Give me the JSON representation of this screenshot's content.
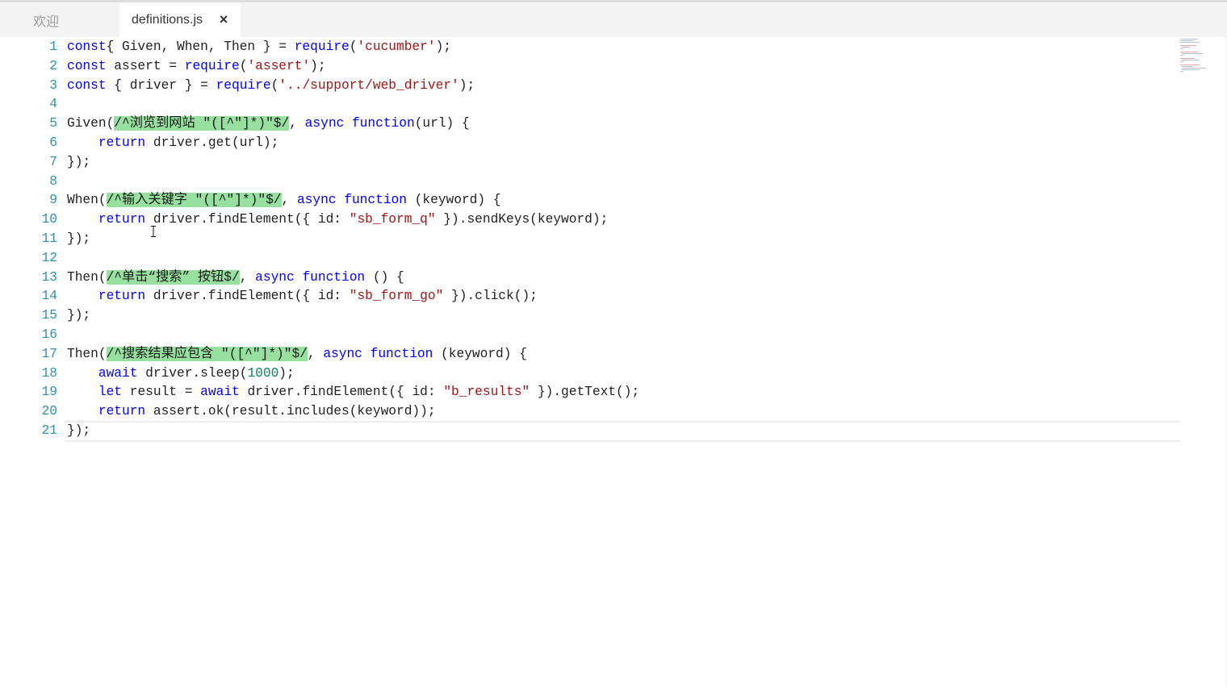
{
  "tabs": [
    {
      "label": "欢迎",
      "active": false
    },
    {
      "label": "definitions.js",
      "active": true,
      "close_icon": "×"
    }
  ],
  "colors": {
    "keyword": "#0000ff",
    "string": "#a31515",
    "number": "#098658",
    "line_number": "#2b91af",
    "regex_highlight": "#98e0a0"
  },
  "editor": {
    "lines": [
      {
        "n": "1",
        "tokens": [
          [
            "kw",
            "const"
          ],
          [
            "",
            "{ Given, When, Then } = "
          ],
          [
            "kw",
            "require"
          ],
          [
            "",
            "("
          ],
          [
            "str",
            "'cucumber'"
          ],
          [
            "",
            ");"
          ]
        ]
      },
      {
        "n": "2",
        "tokens": [
          [
            "kw",
            "const"
          ],
          [
            "",
            " assert = "
          ],
          [
            "kw",
            "require"
          ],
          [
            "",
            "("
          ],
          [
            "str",
            "'assert'"
          ],
          [
            "",
            ");"
          ]
        ]
      },
      {
        "n": "3",
        "tokens": [
          [
            "kw",
            "const"
          ],
          [
            "",
            " { driver } = "
          ],
          [
            "kw",
            "require"
          ],
          [
            "",
            "("
          ],
          [
            "str",
            "'../support/web_driver'"
          ],
          [
            "",
            ");"
          ]
        ]
      },
      {
        "n": "4",
        "tokens": []
      },
      {
        "n": "5",
        "tokens": [
          [
            "",
            "Given("
          ],
          [
            "rx",
            "/^浏览到网站 \"([^\"]*)\"$/"
          ],
          [
            "",
            ", "
          ],
          [
            "kw",
            "async"
          ],
          [
            "",
            " "
          ],
          [
            "kw",
            "function"
          ],
          [
            "",
            "(url) {"
          ]
        ]
      },
      {
        "n": "6",
        "tokens": [
          [
            "",
            "    "
          ],
          [
            "kw",
            "return"
          ],
          [
            "",
            " driver.get(url);"
          ]
        ]
      },
      {
        "n": "7",
        "tokens": [
          [
            "",
            "});"
          ]
        ]
      },
      {
        "n": "8",
        "tokens": []
      },
      {
        "n": "9",
        "tokens": [
          [
            "",
            "When("
          ],
          [
            "rx",
            "/^输入关键字 \"([^\"]*)\"$/"
          ],
          [
            "",
            ", "
          ],
          [
            "kw",
            "async"
          ],
          [
            "",
            " "
          ],
          [
            "kw",
            "function"
          ],
          [
            "",
            " (keyword) {"
          ]
        ]
      },
      {
        "n": "10",
        "tokens": [
          [
            "",
            "    "
          ],
          [
            "kw",
            "return"
          ],
          [
            "",
            " driver.findElement({ id: "
          ],
          [
            "str",
            "\"sb_form_q\""
          ],
          [
            "",
            " }).sendKeys(keyword);"
          ]
        ]
      },
      {
        "n": "11",
        "tokens": [
          [
            "",
            "});"
          ]
        ]
      },
      {
        "n": "12",
        "tokens": []
      },
      {
        "n": "13",
        "tokens": [
          [
            "",
            "Then("
          ],
          [
            "rx",
            "/^单击“搜索” 按钮$/"
          ],
          [
            "",
            ", "
          ],
          [
            "kw",
            "async"
          ],
          [
            "",
            " "
          ],
          [
            "kw",
            "function"
          ],
          [
            "",
            " () {"
          ]
        ]
      },
      {
        "n": "14",
        "tokens": [
          [
            "",
            "    "
          ],
          [
            "kw",
            "return"
          ],
          [
            "",
            " driver.findElement({ id: "
          ],
          [
            "str",
            "\"sb_form_go\""
          ],
          [
            "",
            " }).click();"
          ]
        ]
      },
      {
        "n": "15",
        "tokens": [
          [
            "",
            "});"
          ]
        ]
      },
      {
        "n": "16",
        "tokens": []
      },
      {
        "n": "17",
        "tokens": [
          [
            "",
            "Then("
          ],
          [
            "rx",
            "/^搜索结果应包含 \"([^\"]*)\"$/"
          ],
          [
            "",
            ", "
          ],
          [
            "kw",
            "async"
          ],
          [
            "",
            " "
          ],
          [
            "kw",
            "function"
          ],
          [
            "",
            " (keyword) {"
          ]
        ]
      },
      {
        "n": "18",
        "tokens": [
          [
            "",
            "    "
          ],
          [
            "kw",
            "await"
          ],
          [
            "",
            " driver.sleep("
          ],
          [
            "num",
            "1000"
          ],
          [
            "",
            ");"
          ]
        ]
      },
      {
        "n": "19",
        "tokens": [
          [
            "",
            "    "
          ],
          [
            "kw",
            "let"
          ],
          [
            "",
            " result = "
          ],
          [
            "kw",
            "await"
          ],
          [
            "",
            " driver.findElement({ id: "
          ],
          [
            "str",
            "\"b_results\""
          ],
          [
            "",
            " }).getText();"
          ]
        ]
      },
      {
        "n": "20",
        "tokens": [
          [
            "",
            "    "
          ],
          [
            "kw",
            "return"
          ],
          [
            "",
            " assert.ok(result.includes(keyword));"
          ]
        ]
      },
      {
        "n": "21",
        "tokens": [
          [
            "",
            "});"
          ]
        ]
      }
    ]
  }
}
